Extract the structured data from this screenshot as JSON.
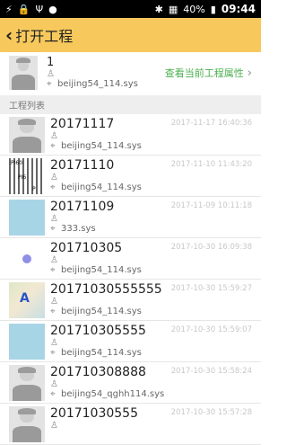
{
  "status_bar": {
    "left_icons": [
      "app-icon",
      "lock-icon",
      "usb-icon",
      "notification-icon"
    ],
    "right_icons": [
      "bluetooth-icon",
      "signal-off-icon"
    ],
    "battery": "40%",
    "time": "09:44"
  },
  "top_bar": {
    "title": "打开工程"
  },
  "current_project": {
    "name": "1",
    "file": "beijing54_114.sys",
    "action_label": "查看当前工程属性"
  },
  "section": {
    "title": "工程列表"
  },
  "projects": [
    {
      "name": "20171117",
      "date": "2017-11-17 16:40:36",
      "file": "beijing54_114.sys"
    },
    {
      "name": "20171110",
      "date": "2017-11-10 11:43:20",
      "file": "beijing54_114.sys"
    },
    {
      "name": "20171109",
      "date": "2017-11-09 10:11:18",
      "file": "333.sys"
    },
    {
      "name": "201710305",
      "date": "2017-10-30 16:09:38",
      "file": "beijing54_114.sys"
    },
    {
      "name": "20171030555555",
      "date": "2017-10-30 15:59:27",
      "file": "beijing54_114.sys"
    },
    {
      "name": "201710305555",
      "date": "2017-10-30 15:59:07",
      "file": "beijing54_114.sys"
    },
    {
      "name": "201710308888",
      "date": "2017-10-30 15:58:24",
      "file": "beijing54_qghh114.sys"
    },
    {
      "name": "20171030555",
      "date": "2017-10-30 15:57:28",
      "file": ""
    }
  ],
  "thumb_text": {
    "p1": "PI60",
    "p2": "PI6",
    "p3": "P",
    "map_letter": "A"
  }
}
